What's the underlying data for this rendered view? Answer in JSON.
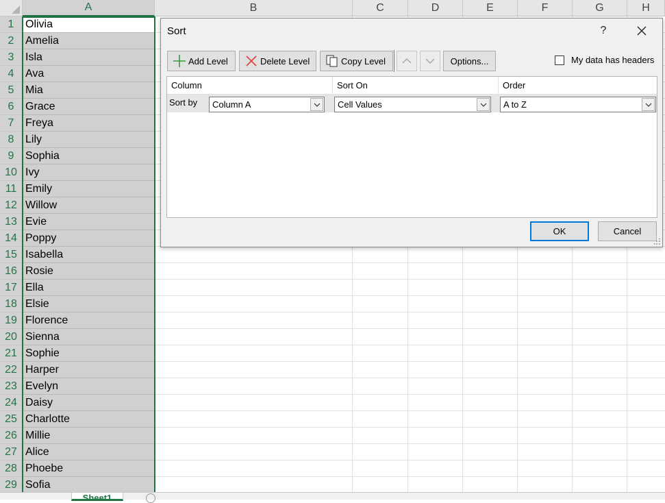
{
  "spreadsheet": {
    "columns": [
      "A",
      "B",
      "C",
      "D",
      "E",
      "F",
      "G",
      "H"
    ],
    "rows": [
      {
        "num": "1",
        "value": "Olivia"
      },
      {
        "num": "2",
        "value": "Amelia"
      },
      {
        "num": "3",
        "value": "Isla"
      },
      {
        "num": "4",
        "value": "Ava"
      },
      {
        "num": "5",
        "value": "Mia"
      },
      {
        "num": "6",
        "value": "Grace"
      },
      {
        "num": "7",
        "value": "Freya"
      },
      {
        "num": "8",
        "value": "Lily"
      },
      {
        "num": "9",
        "value": "Sophia"
      },
      {
        "num": "10",
        "value": "Ivy"
      },
      {
        "num": "11",
        "value": "Emily"
      },
      {
        "num": "12",
        "value": "Willow"
      },
      {
        "num": "13",
        "value": "Evie"
      },
      {
        "num": "14",
        "value": "Poppy"
      },
      {
        "num": "15",
        "value": "Isabella"
      },
      {
        "num": "16",
        "value": "Rosie"
      },
      {
        "num": "17",
        "value": "Ella"
      },
      {
        "num": "18",
        "value": "Elsie"
      },
      {
        "num": "19",
        "value": "Florence"
      },
      {
        "num": "20",
        "value": "Sienna"
      },
      {
        "num": "21",
        "value": "Sophie"
      },
      {
        "num": "22",
        "value": "Harper"
      },
      {
        "num": "23",
        "value": "Evelyn"
      },
      {
        "num": "24",
        "value": "Daisy"
      },
      {
        "num": "25",
        "value": "Charlotte"
      },
      {
        "num": "26",
        "value": "Millie"
      },
      {
        "num": "27",
        "value": "Alice"
      },
      {
        "num": "28",
        "value": "Phoebe"
      },
      {
        "num": "29",
        "value": "Sofia"
      }
    ],
    "sheet_tab": "Sheet1",
    "accent_color": "#217346"
  },
  "dialog": {
    "title": "Sort",
    "help_label": "?",
    "toolbar": {
      "add_level": "Add Level",
      "delete_level": "Delete Level",
      "copy_level": "Copy Level",
      "options": "Options..."
    },
    "headers_checkbox": {
      "label": "My data has headers",
      "checked": false
    },
    "table": {
      "col_column": "Column",
      "col_sort_on": "Sort On",
      "col_order": "Order",
      "level": {
        "label": "Sort by",
        "column": "Column A",
        "sort_on": "Cell Values",
        "order": "A to Z"
      }
    },
    "ok_label": "OK",
    "cancel_label": "Cancel"
  }
}
